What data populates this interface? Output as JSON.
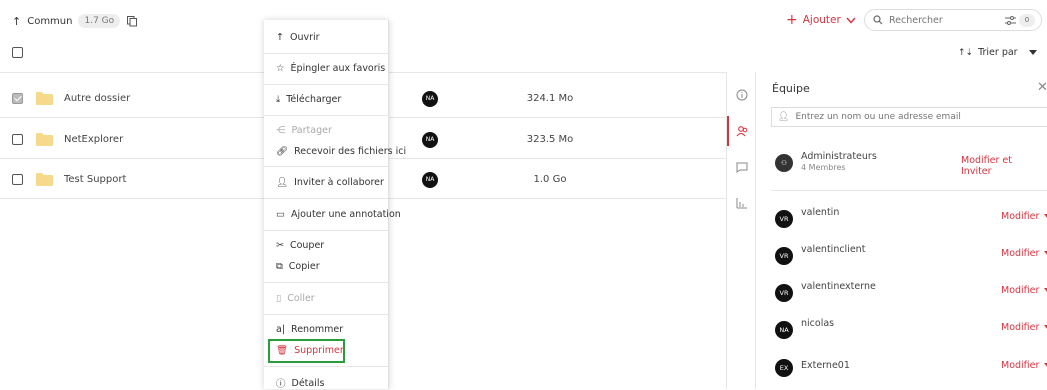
{
  "breadcrumb": {
    "label": "Commun",
    "size": "1.7 Go"
  },
  "toolbar": {
    "add_label": "Ajouter",
    "search_placeholder": "Rechercher",
    "filter_count": "0",
    "sort_label": "Trier par"
  },
  "files": [
    {
      "name": "Autre dossier",
      "owner": "NA",
      "size": "324.1 Mo",
      "checked": true
    },
    {
      "name": "NetExplorer",
      "owner": "NA",
      "size": "323.5 Mo",
      "checked": false
    },
    {
      "name": "Test Support",
      "owner": "NA",
      "size": "1.0 Go",
      "checked": false
    }
  ],
  "context_menu": {
    "open": "Ouvrir",
    "pin": "Épingler aux favoris",
    "download": "Télécharger",
    "share": "Partager",
    "receive": "Recevoir des fichiers ici",
    "invite": "Inviter à collaborer",
    "annotate": "Ajouter une annotation",
    "cut": "Couper",
    "copy": "Copier",
    "paste": "Coller",
    "rename": "Renommer",
    "delete": "Supprimer",
    "details": "Détails"
  },
  "panel": {
    "title": "Équipe",
    "input_placeholder": "Entrez un nom ou une adresse email",
    "group": {
      "name": "Administrateurs",
      "sub": "4 Membres",
      "action": "Modifier et Inviter"
    },
    "members": [
      {
        "initials": "VR",
        "name": "valentin",
        "action": "Modifier"
      },
      {
        "initials": "VR",
        "name": "valentinclient",
        "action": "Modifier"
      },
      {
        "initials": "VR",
        "name": "valentinexterne",
        "action": "Modifier"
      },
      {
        "initials": "NA",
        "name": "nicolas",
        "action": "Modifier"
      },
      {
        "initials": "EX",
        "name": "Externe01",
        "action": "Modifier"
      }
    ]
  },
  "colors": {
    "accent": "#d9333f",
    "highlight": "#2a9d3a",
    "folder": "#f6d98a"
  }
}
